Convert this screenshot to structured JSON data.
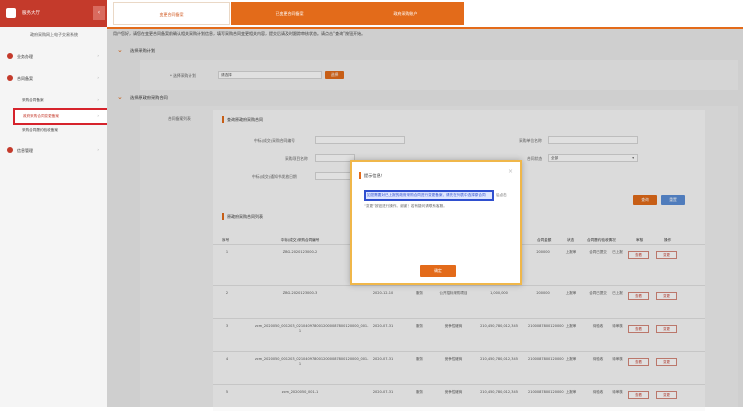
{
  "sidebar": {
    "brand_title": "服务大厅",
    "collapse_icon": "‹",
    "heading": "政府采购网上电子交易系统",
    "items": [
      {
        "label": "业务办理",
        "arrow": "›"
      },
      {
        "label": "合同备案",
        "arrow": "›"
      }
    ],
    "sub_items": [
      {
        "label": "采购合同备案",
        "arrow": "›"
      },
      {
        "label": "政府采购合同变更备案",
        "arrow": "›"
      },
      {
        "label": "采购合同履约验收备案",
        "arrow": ""
      }
    ],
    "items_after": [
      {
        "label": "信息管理",
        "arrow": "›"
      }
    ]
  },
  "tabs": [
    {
      "label": "变更合同备案"
    },
    {
      "label": "已变更合同备案"
    },
    {
      "label": "政府采购账户"
    }
  ],
  "notice": "用户您好，请您在变更合同备案前确认相关采购计划信息，填写采购合同变更相关内容，提交后请及时跟踪审核状态。请点击“查询”按钮开始。",
  "section1": {
    "title": "选择采购计划",
    "label": "* 选择采购计划",
    "input_value": "请选择",
    "button": "选择"
  },
  "section2": {
    "title": "选择原政府采购合同",
    "left_label": "合同备案列表",
    "sub_title": "查询原政府采购合同",
    "fields": {
      "contract_no_label": "中标(成交)采购合同编号",
      "supplier_label": "采购单位名称",
      "buyer_label": "采购项目名称",
      "status_label": "合同状态",
      "status_value": "全部",
      "date_label": "中标(成交)通知书发放日期"
    },
    "query_button": "查询",
    "reset_button": "重置"
  },
  "list": {
    "title": "原政府采购合同列表",
    "headers": [
      "序号",
      "中标(成交)采购合同编号",
      "签订日期",
      "类型",
      "采购方式",
      "合同金额",
      "合同金额",
      "状态",
      "合同履约验收情况",
      "审核",
      "操作"
    ],
    "rows": [
      {
        "no": "1",
        "contract": "ZBG-2020123000-2",
        "date": "",
        "type": "",
        "method": "",
        "amount": "",
        "amount2": "200000",
        "status": "上报审",
        "check": "合同已提交",
        "review": "已上报",
        "view": "查看",
        "edit": "变更"
      },
      {
        "no": "2",
        "contract": "ZBG-2020123000-3",
        "date": "2020-12-10",
        "type": "服务",
        "method": "公开招标采购项目",
        "amount": "1,000,000",
        "amount2": "200000",
        "status": "上报审",
        "check": "合同已提交",
        "review": "已上报",
        "view": "查看",
        "edit": "变更"
      },
      {
        "no": "3",
        "contract": "zcm_2020050_001203_0210409780012000087800120000_001-1",
        "date": "2020-07-31",
        "type": "服务",
        "method": "竞争性磋商",
        "amount": "210,450,780,012,345",
        "amount2": "2100087800120000",
        "status": "上报审",
        "check": "待验收",
        "review": "待审核",
        "view": "查看",
        "edit": "变更"
      },
      {
        "no": "4",
        "contract": "zcm_2020050_001203_0210409780012000087800120000_001-1",
        "date": "2020-07-31",
        "type": "服务",
        "method": "竞争性磋商",
        "amount": "210,450,780,012,345",
        "amount2": "2100087800120000",
        "status": "上报审",
        "check": "待验收",
        "review": "待审核",
        "view": "查看",
        "edit": "变更"
      },
      {
        "no": "5",
        "contract": "zcm_2020050_001-1",
        "date": "2020-07-31",
        "type": "服务",
        "method": "竞争性磋商",
        "amount": "210,450,780,012,345",
        "amount2": "2100087800120000",
        "status": "上报审",
        "check": "待验收",
        "review": "待审核",
        "view": "查看",
        "edit": "变更"
      }
    ]
  },
  "dialog": {
    "title": "提示信息！",
    "close": "×",
    "line1_highlight": "如您需要对已上报的政府采购合同进行变更备案，请先在列表中选择原合同",
    "line1_tail": "后点击",
    "line2": "“变更”按钮进行操作。谢谢！若有疑问请联系客服。",
    "ok_button": "确定"
  },
  "colors": {
    "brand": "#c43a2b",
    "accent": "#e36b1a",
    "highlight": "#2f4fcf"
  }
}
